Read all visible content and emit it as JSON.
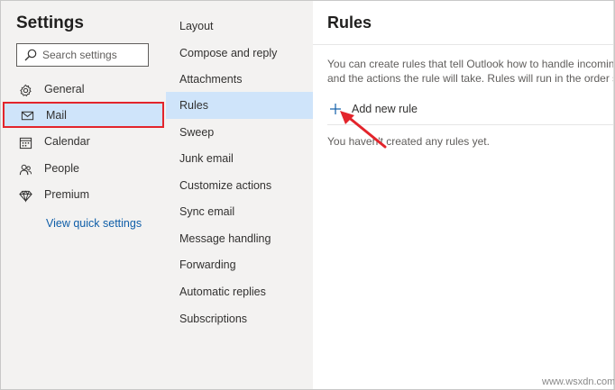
{
  "settings": {
    "title": "Settings",
    "search_placeholder": "Search settings",
    "nav": [
      {
        "label": "General",
        "icon": "gear-icon"
      },
      {
        "label": "Mail",
        "icon": "mail-icon"
      },
      {
        "label": "Calendar",
        "icon": "calendar-icon"
      },
      {
        "label": "People",
        "icon": "people-icon"
      },
      {
        "label": "Premium",
        "icon": "diamond-icon"
      }
    ],
    "view_quick_settings": "View quick settings"
  },
  "mail_sections": [
    "Layout",
    "Compose and reply",
    "Attachments",
    "Rules",
    "Sweep",
    "Junk email",
    "Customize actions",
    "Sync email",
    "Message handling",
    "Forwarding",
    "Automatic replies",
    "Subscriptions"
  ],
  "active_section": "Rules",
  "rules": {
    "title": "Rules",
    "description_line1": "You can create rules that tell Outlook how to handle incoming e",
    "description_line2": "and the actions the rule will take. Rules will run in the order sho",
    "add_rule_label": "Add new rule",
    "empty_message": "You haven't created any rules yet."
  },
  "colors": {
    "selected_bg": "#cfe4fa",
    "highlight_border": "#e3242b",
    "link": "#0f5ea8",
    "annotation_arrow": "#e3242b"
  },
  "watermark": "www.wsxdn.com"
}
